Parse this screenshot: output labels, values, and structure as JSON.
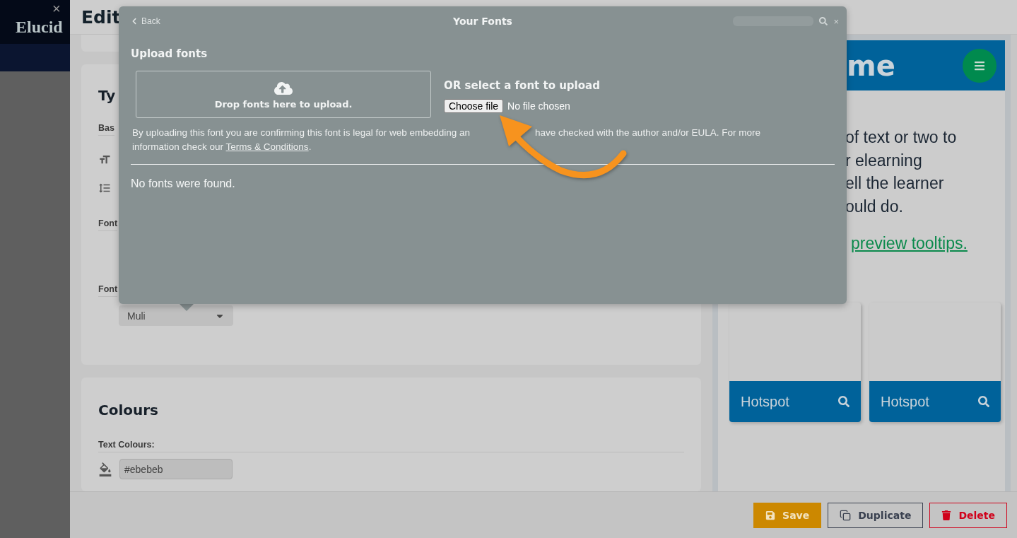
{
  "app": {
    "logo": "Elucid",
    "close": "×"
  },
  "editor": {
    "title": "Edit",
    "typography": {
      "heading": "Ty",
      "base_label": "Bas",
      "font_labels": [
        "Font",
        "Font"
      ],
      "font_select": {
        "value": "Muli"
      }
    },
    "colours": {
      "heading": "Colours",
      "text_colours_label": "Text Colours:",
      "fields": [
        {
          "value": "#ebebeb"
        }
      ]
    }
  },
  "preview": {
    "header_title": "me",
    "body_lines": [
      "of text or two to",
      "r elearning",
      "ell the learner",
      "ould do."
    ],
    "link": "preview tooltips.",
    "hotspots": [
      {
        "label": "Hotspot"
      },
      {
        "label": "Hotspot"
      }
    ]
  },
  "modal": {
    "back": "Back",
    "title": "Your Fonts",
    "upload_heading": "Upload fonts",
    "dropzone": "Drop fonts here to upload.",
    "or_heading": "OR select a font to upload",
    "file_button": "Choose file",
    "file_status": "No file chosen",
    "notice": {
      "before_arrow": "By uploading this font you are confirming this font is legal for web embedding an",
      "after_arrow": "have checked with the author and/or EULA. For more",
      "second_line": "information check our ",
      "terms_link": "Terms & Conditions",
      "end": "."
    },
    "empty": "No fonts were found."
  },
  "footer": {
    "buttons": [
      {
        "kind": "save",
        "label": "Save"
      },
      {
        "kind": "duplicate",
        "label": "Duplicate"
      },
      {
        "kind": "delete",
        "label": "Delete"
      }
    ]
  }
}
